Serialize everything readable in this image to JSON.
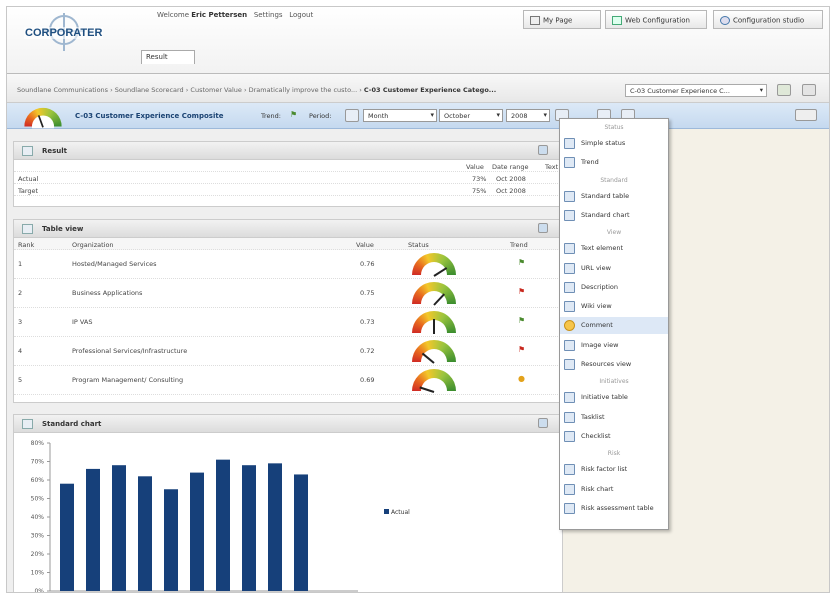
{
  "brand": {
    "logo": "CORPORATER"
  },
  "header": {
    "welcome_prefix": "Welcome",
    "user": "Eric Pettersen",
    "settings": "Settings",
    "logout": "Logout",
    "tab_result": "Result",
    "buttons": {
      "my_page": "My Page",
      "web_config": "Web Configuration",
      "config_studio": "Configuration studio"
    }
  },
  "breadcrumb": {
    "path": "Soundlane Communications › Soundlane Scorecard › Customer Value › Dramatically improve the custo... › ",
    "current": "C-03 Customer Experience Catego...",
    "kpi_select": "C-03 Customer Experience C..."
  },
  "kpibar": {
    "title": "C-03 Customer Experience Composite",
    "trend_label": "Trend:",
    "period_label": "Period:",
    "period_type": "Month",
    "month": "October",
    "year": "2008"
  },
  "result": {
    "title": "Result",
    "columns": [
      "Value",
      "Date range",
      "Text"
    ],
    "rows": [
      {
        "label": "Actual",
        "value": "73%",
        "date": "Oct 2008"
      },
      {
        "label": "Target",
        "value": "75%",
        "date": "Oct 2008"
      }
    ]
  },
  "table_view": {
    "title": "Table view",
    "columns": [
      "Rank",
      "Organization",
      "Value",
      "Status",
      "Trend"
    ],
    "rows": [
      {
        "rank": "1",
        "org": "Hosted/Managed Services",
        "value": "0.76",
        "needle": 0.82,
        "trend": "up",
        "trend_color": "#4a8a2e"
      },
      {
        "rank": "2",
        "org": "Business Applications",
        "value": "0.75",
        "needle": 0.74,
        "trend": "down",
        "trend_color": "#c8281e"
      },
      {
        "rank": "3",
        "org": "IP VAS",
        "value": "0.73",
        "needle": 0.5,
        "trend": "up",
        "trend_color": "#4a8a2e"
      },
      {
        "rank": "4",
        "org": "Professional Services/Infrastructure",
        "value": "0.72",
        "needle": 0.22,
        "trend": "down",
        "trend_color": "#c8281e"
      },
      {
        "rank": "5",
        "org": "Program Management/ Consulting",
        "value": "0.69",
        "needle": 0.1,
        "trend": "flat",
        "trend_color": "#e3a21b"
      }
    ]
  },
  "standard_chart": {
    "title": "Standard chart"
  },
  "chart_data": {
    "type": "bar",
    "title": "",
    "xlabel": "",
    "ylabel": "",
    "y_ticks": [
      "80%",
      "70%",
      "60%",
      "50%",
      "40%",
      "30%",
      "20%",
      "10%",
      "0%"
    ],
    "ylim": [
      0,
      80
    ],
    "values": [
      58,
      66,
      68,
      62,
      55,
      64,
      71,
      68,
      69,
      63
    ],
    "series": [
      {
        "name": "Actual"
      }
    ],
    "legend": "right",
    "bar_color": "#16407a"
  },
  "menu": {
    "items": [
      {
        "type": "sep",
        "label": "Status"
      },
      {
        "type": "item",
        "label": "Simple status",
        "icon": "status-icon"
      },
      {
        "type": "item",
        "label": "Trend",
        "icon": "trend-icon"
      },
      {
        "type": "sep",
        "label": "Standard"
      },
      {
        "type": "item",
        "label": "Standard table",
        "icon": "table-icon"
      },
      {
        "type": "item",
        "label": "Standard chart",
        "icon": "chart-icon"
      },
      {
        "type": "sep",
        "label": "View"
      },
      {
        "type": "item",
        "label": "Text element",
        "icon": "text-icon"
      },
      {
        "type": "item",
        "label": "URL view",
        "icon": "url-icon"
      },
      {
        "type": "item",
        "label": "Description",
        "icon": "info-icon"
      },
      {
        "type": "item",
        "label": "Wiki view",
        "icon": "wiki-icon"
      },
      {
        "type": "item",
        "label": "Comment",
        "icon": "comment-icon",
        "highlight": true
      },
      {
        "type": "item",
        "label": "Image view",
        "icon": "image-icon"
      },
      {
        "type": "item",
        "label": "Resources view",
        "icon": "resources-icon"
      },
      {
        "type": "sep",
        "label": "Initiatives"
      },
      {
        "type": "item",
        "label": "Initiative table",
        "icon": "initiative-icon"
      },
      {
        "type": "item",
        "label": "Tasklist",
        "icon": "tasklist-icon"
      },
      {
        "type": "item",
        "label": "Checklist",
        "icon": "checklist-icon"
      },
      {
        "type": "sep",
        "label": "Risk"
      },
      {
        "type": "item",
        "label": "Risk factor list",
        "icon": "risk-list-icon"
      },
      {
        "type": "item",
        "label": "Risk chart",
        "icon": "risk-chart-icon"
      },
      {
        "type": "item",
        "label": "Risk assessment table",
        "icon": "risk-table-icon"
      }
    ]
  }
}
